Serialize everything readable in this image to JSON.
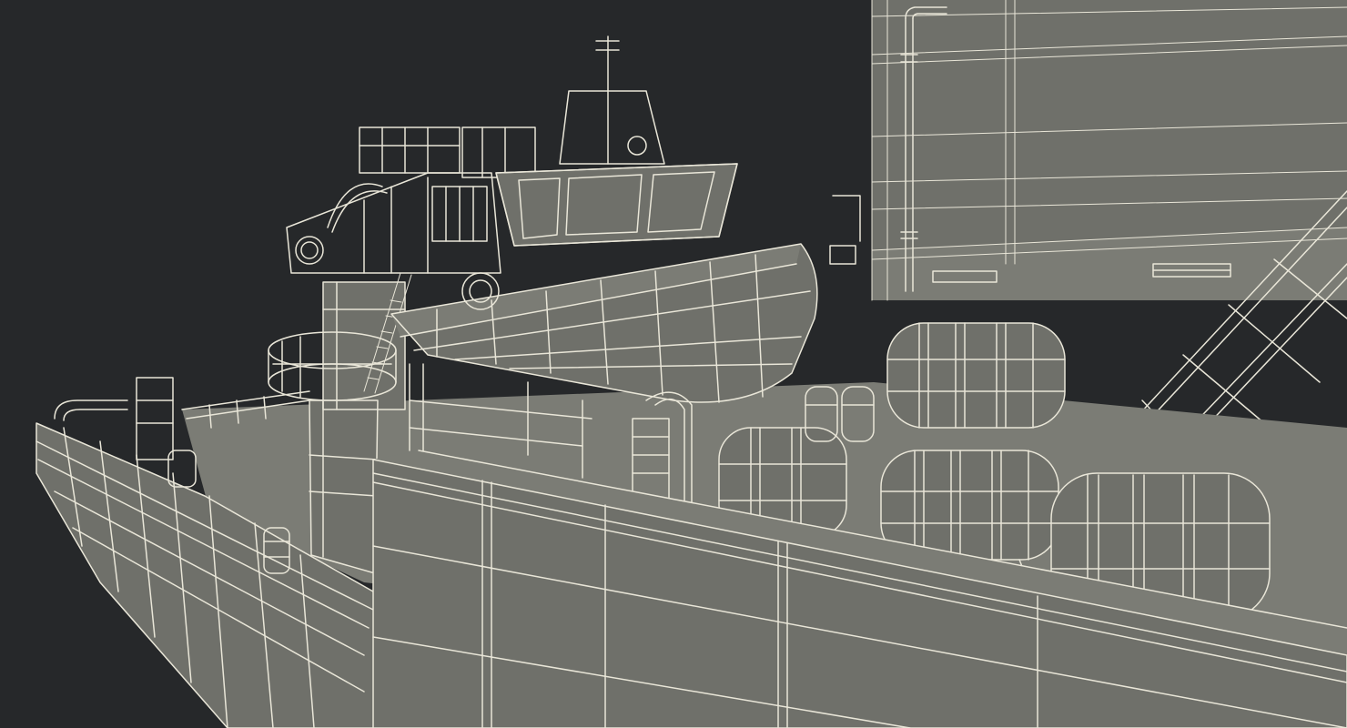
{
  "render": {
    "background_color": "#26282a",
    "hull_fill": "#6f706a",
    "hull_shadow": "#55564f",
    "deck_fill": "#7b7c75",
    "wire_color": "#e9e6d8",
    "wire_dim": "#c9c6b8"
  },
  "objects": {
    "hull": "ship-hull",
    "superstructure": "bridge-superstructure",
    "lifeboat": "rescue-boat",
    "tanks": "horizontal-tanks",
    "crane": "deck-crane",
    "stairs": "external-stairway"
  }
}
